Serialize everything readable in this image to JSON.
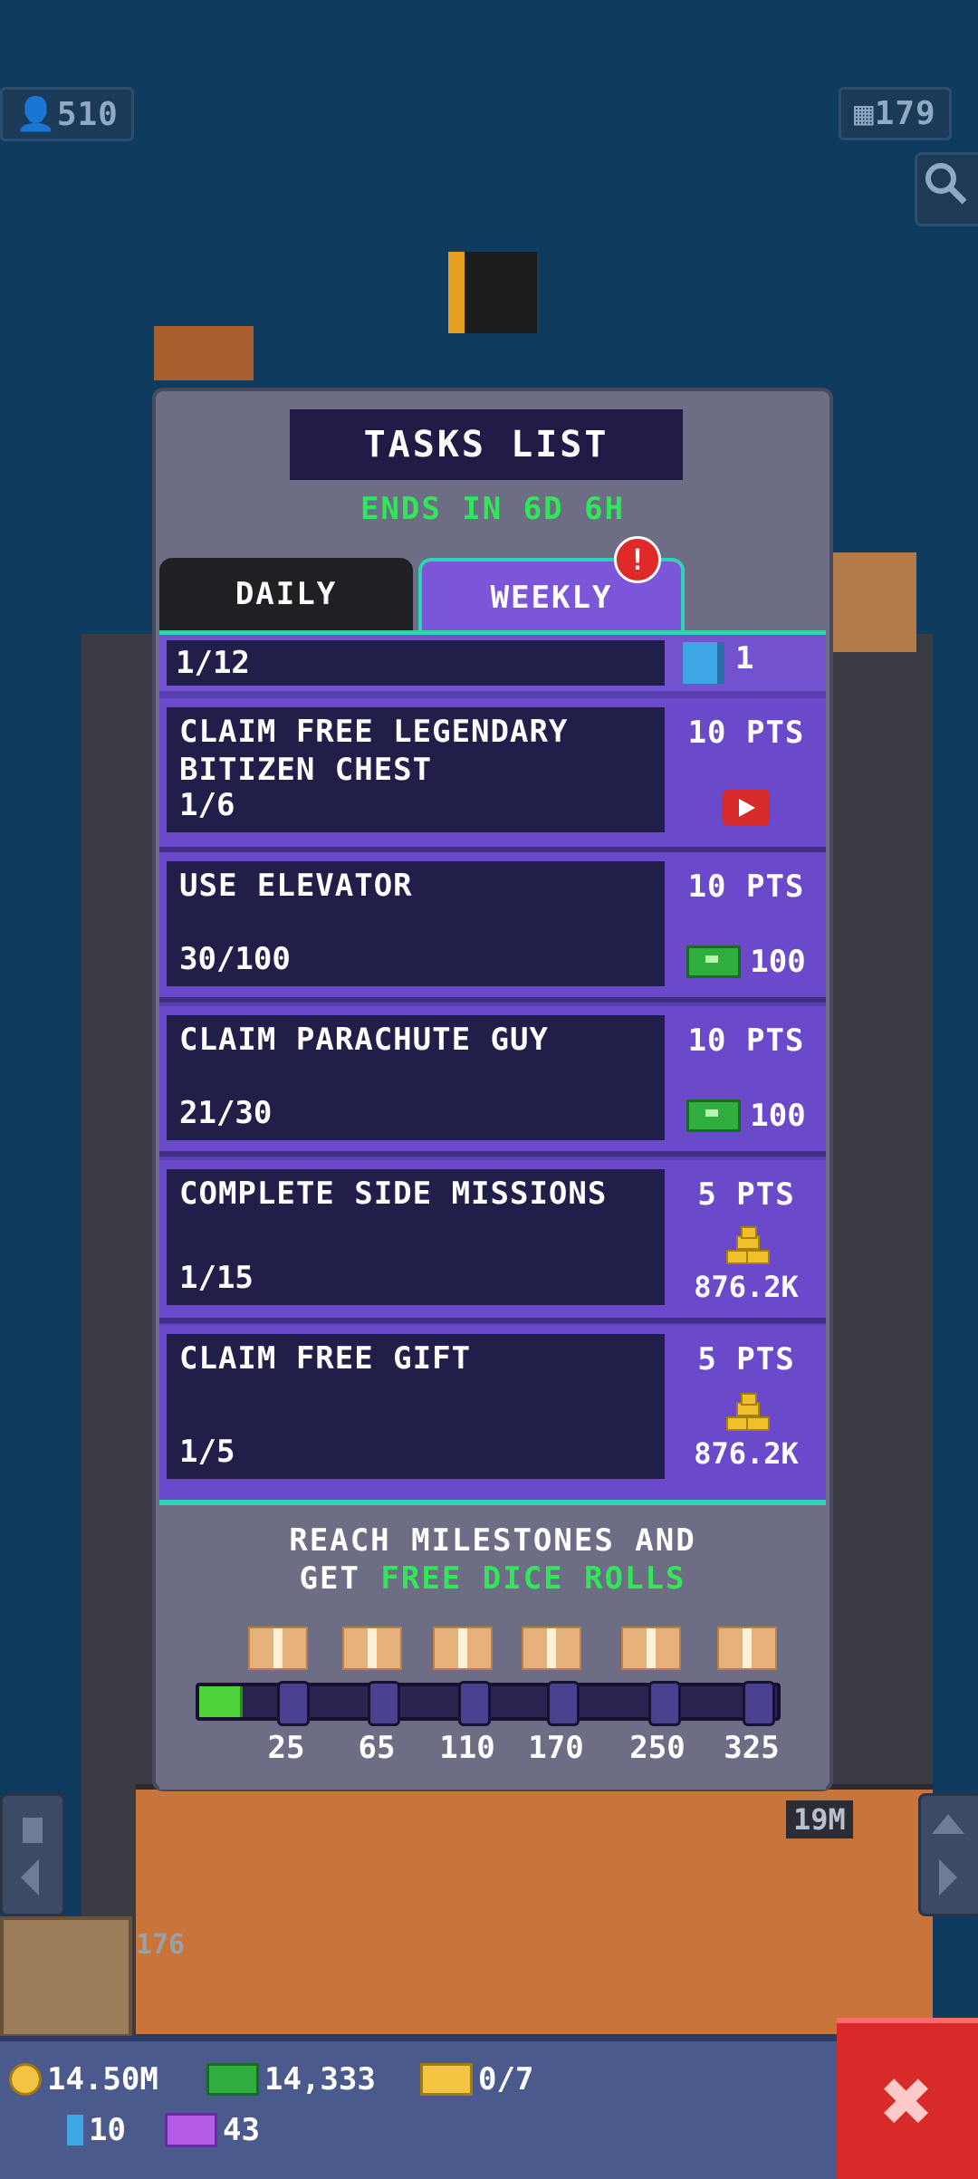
{
  "status": {
    "population": "510",
    "floors": "179",
    "population_icon": "person-icon",
    "floors_icon": "building-icon"
  },
  "modal": {
    "title": "TASKS LIST",
    "ends": "ENDS IN 6D 6H",
    "tabs": {
      "daily": "DAILY",
      "weekly": "WEEKLY"
    },
    "alert": "!",
    "progress": {
      "text": "1/12",
      "tickets": "1"
    },
    "tasks": [
      {
        "title": "CLAIM FREE LEGENDARY BITIZEN CHEST",
        "progress": "1/6",
        "pts": "10 PTS",
        "reward_icon": "video-icon",
        "reward": ""
      },
      {
        "title": "USE ELEVATOR",
        "progress": "30/100",
        "pts": "10 PTS",
        "reward_icon": "cash-icon",
        "reward": "100"
      },
      {
        "title": "CLAIM PARACHUTE GUY",
        "progress": "21/30",
        "pts": "10 PTS",
        "reward_icon": "cash-icon",
        "reward": "100"
      },
      {
        "title": "COMPLETE SIDE MISSIONS",
        "progress": "1/15",
        "pts": "5 PTS",
        "reward_icon": "coins-icon",
        "reward": "876.2K"
      },
      {
        "title": "CLAIM FREE GIFT",
        "progress": "1/5",
        "pts": "5 PTS",
        "reward_icon": "coins-icon",
        "reward": "876.2K"
      }
    ],
    "milestones": {
      "line1": "REACH MILESTONES AND",
      "line2a": "GET ",
      "line2b": "FREE DICE ROLLS",
      "labels": [
        "25",
        "65",
        "110",
        "170",
        "250",
        "325"
      ],
      "progress_fraction": 0.07
    }
  },
  "resources": {
    "coins": "14.50M",
    "bux": "14,333",
    "golden_tickets": "0/7",
    "tickets": "10",
    "purple_tickets": "43"
  },
  "tower_labels": {
    "floor_176": "176",
    "floor_19m": "19M"
  },
  "close_label": "✖"
}
